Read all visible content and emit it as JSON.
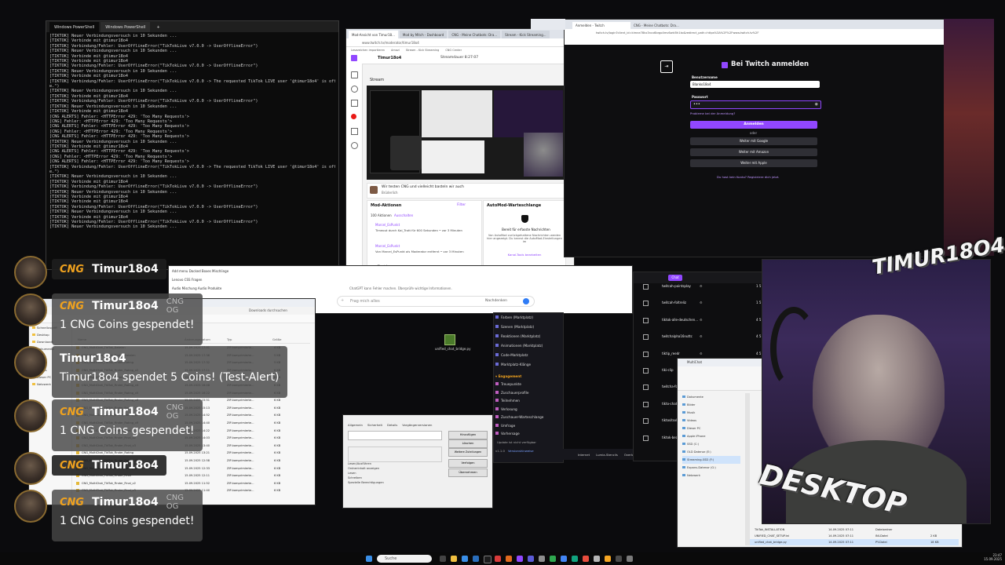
{
  "terminal": {
    "tabs": [
      "Windows PowerShell",
      "Windows PowerShell"
    ],
    "lines": [
      "[TIKTOK] Neuer Verbindungsversuch in 10 Sekunden ...",
      "[TIKTOK] Verbinde mit @timur18o4",
      "[TIKTOK] Verbindung/Fehler: UserOfflineError(\"TikTokLive v7.0.0 -> UserOfflineError\")",
      "[TIKTOK] Neuer Verbindungsversuch in 10 Sekunden ...",
      "[TIKTOK] Verbinde mit @timur18o4",
      "[TIKTOK] Verbinde mit @timur18o4",
      "[TIKTOK] Verbindung/Fehler: UserOfflineError(\"TikTokLive v7.0.0 -> UserOfflineError\")",
      "[TIKTOK] Neuer Verbindungsversuch in 10 Sekunden ...",
      "[TIKTOK] Verbinde mit @timur18o4",
      "[TIKTOK] Verbindung/Fehler: UserOfflineError(\"TikTokLive v7.0.0 -> The requested TikTok LIVE user '@timur18o4' is offlin",
      "e.\")",
      "[TIKTOK] Neuer Verbindungsversuch in 10 Sekunden ...",
      "[TIKTOK] Verbinde mit @timur18o4",
      "[TIKTOK] Verbindung/Fehler: UserOfflineError(\"TikTokLive v7.0.0 -> UserOfflineError\")",
      "[TIKTOK] Neuer Verbindungsversuch in 10 Sekunden ...",
      "[TIKTOK] Verbinde mit @timur18o4",
      "[CNG ALERTS] Fehler: <HTTPError 429: 'Too Many Requests'>",
      "[CNG] Fehler: <HTTPError 429: 'Too Many Requests'>",
      "[CNG ALERTS] Fehler: <HTTPError 429: 'Too Many Requests'>",
      "[CNG] Fehler: <HTTPError 429: 'Too Many Requests'>",
      "[CNG ALERTS] Fehler: <HTTPError 429: 'Too Many Requests'>",
      "[TIKTOK] Neuer Verbindungsversuch in 10 Sekunden ...",
      "[TIKTOK] Verbinde mit @timur18o4",
      "[CNG ALERTS] Fehler: <HTTPError 429: 'Too Many Requests'>",
      "[CNG] Fehler: <HTTPError 429: 'Too Many Requests'>",
      "[CNG ALERTS] Fehler: <HTTPError 429: 'Too Many Requests'>",
      "[TIKTOK] Verbindung/Fehler: UserOfflineError(\"TikTokLive v7.0.0 -> The requested TikTok LIVE user '@timur18o4' is offlin",
      "e.\")",
      "[TIKTOK] Neuer Verbindungsversuch in 10 Sekunden ...",
      "[TIKTOK] Verbinde mit @timur18o4",
      "[TIKTOK] Verbindung/Fehler: UserOfflineError(\"TikTokLive v7.0.0 -> UserOfflineError\")",
      "[TIKTOK] Neuer Verbindungsversuch in 10 Sekunden ...",
      "[TIKTOK] Verbinde mit @timur18o4",
      "[TIKTOK] Verbinde mit @timur18o4",
      "[TIKTOK] Verbindung/Fehler: UserOfflineError(\"TikTokLive v7.0.0 -> UserOfflineError\")",
      "[TIKTOK] Neuer Verbindungsversuch in 10 Sekunden ...",
      "[TIKTOK] Verbinde mit @timur18o4",
      "[TIKTOK] Verbindung/Fehler: UserOfflineError(\"TikTokLive v7.0.0 -> UserOfflineError\")",
      "[TIKTOK] Neuer Verbindungsversuch in 10 Sekunden ..."
    ]
  },
  "browser_main": {
    "tabs": [
      "Mod-Ansicht von Timur18...",
      "Mod by Mitch - Dashboard",
      "CNG - Meine Chatbots: Dra...",
      "Stream - Kick Streaming..."
    ],
    "address": "www.twitch.tv/moderator/timur18o4",
    "bookmarks": [
      "Lesezeichen importieren",
      "Amazi",
      "Stream - Kick Streaming",
      "CNG Center",
      "Mein Alexa für aus. Tipp",
      "Mein Account Plus"
    ],
    "channel": "Timur18o4",
    "uptime": "Streamdauer 8:27:07",
    "section_stream": "Stream",
    "chat_msg": "Wir testen CNG und vielleicht basteln wir auch",
    "chat_sub": "Brüderlich",
    "mod_actions_title": "Mod-Aktionen",
    "filter": "Filter",
    "automod_title": "AutoMod-Warteschlange",
    "mod_count": "100 Aktionen",
    "mod_count_link": "Ausschalten",
    "mod_entries": [
      {
        "user": "Marcel_EsPunkt",
        "text": "Timeout durch Kai_Trott für 600 Sekunden • vor 3 Minuten"
      },
      {
        "user": "Marcel_EsPunkt",
        "text": "Von Marcel_EsPunkt als Moderator entfernt • vor 3 Minuten"
      }
    ],
    "automod_ready": "Bereit für erfasste Nachrichten",
    "automod_desc": "Von AutoMod zurückgehaltene Nachrichten werden hier angezeigt. Du kannst die AutoMod-Einstellungen im",
    "automod_link": "Kanal-Tools bearbeiten",
    "chat_clear": "Chat leeren"
  },
  "twitch_login": {
    "tab": "Anmelden - Twitch",
    "tab2": "CNG - Meine Chatbots: Dra...",
    "tab3": "CNG Host",
    "address": "twitch.tv/login?client_id=kimne78kx3ncx6brgo4mv6wki5h1ko&redirect_path=https%3A%2F%2Fwww.twitch.tv%2F",
    "title": "Bei Twitch anmelden",
    "username_label": "Benutzername",
    "username_value": "Blanko18o4",
    "password_label": "Passwort",
    "password_value": "•••",
    "trouble_link": "Probleme bei der Anmeldung?",
    "login_button": "Anmelden",
    "or": "oder",
    "google": "Weiter mit Google",
    "amazon": "Weiter mit Amazon",
    "apple": "Weiter mit Apple",
    "register": "Du hast kein Konto? Registriere dich jetzt."
  },
  "google_bar": {
    "placeholder": "Frag mich alles",
    "btn": "Nachdenken",
    "hint": "ChatGPT kann Fehler machen. Überprüfe wichtige Informationen."
  },
  "explorer_left": {
    "suggestions": [
      "Add menu Docked Boxes Mischlinge",
      "Lenovo CSS Fragen",
      "Audio Mischung Audio Produkte"
    ],
    "path": "Downloads › unified_chat",
    "search": "Downloads durchsuchen",
    "cols": [
      "Name",
      "Änderungsdatum",
      "Typ",
      "Größe"
    ],
    "rows": [
      [
        "CNG_MultiChat_TikTok_Dateien",
        "15.09.2025 17:41",
        "ZIP-komprimierte...",
        "4 KB"
      ],
      [
        "CNG_MultiChat_TikTok_Finder_Dateien",
        "15.09.2025 17:36",
        "ZIP-komprimierte...",
        "5 KB"
      ],
      [
        "CNG_MultiChat_TikTok_Finder_Rating",
        "15.09.2025 17:32",
        "ZIP-komprimierte...",
        "5 KB"
      ],
      [
        "CNG_MultiChat_TikTok_Finder_Rating_v2",
        "15.09.2025 17:11",
        "ZIP-komprimierte...",
        "6 KB"
      ],
      [
        "CNG_MultiChat_TikTok_Finder_Rating_v3",
        "15.09.2025 17:06",
        "ZIP-komprimierte...",
        "6 KB"
      ],
      [
        "CNG_MultiChat_TikTok_Finder_Rating_v4",
        "15.09.2025 16:48",
        "ZIP-komprimierte...",
        "6 KB"
      ],
      [
        "CNG_MultiChat_TikTok_Finder_Rating_v5",
        "15.09.2025 16:22",
        "ZIP-komprimierte...",
        "6 KB"
      ],
      [
        "CNG_MultiChat_TikTok_Finder_Rating_v6",
        "15.09.2025 15:51",
        "ZIP-komprimierte...",
        "6 KB"
      ],
      [
        "CNG_MultiChat_TikTok_Finder_Rating_v7",
        "15.09.2025 15:13",
        "ZIP-komprimierte...",
        "6 KB"
      ],
      [
        "CNG_MultiChat_TikTok_Finder_Rating_v8",
        "15.09.2025 14:52",
        "ZIP-komprimierte...",
        "6 KB"
      ],
      [
        "CNG_MultiChat_TikTok_Finder_Rating_v9",
        "15.09.2025 14:40",
        "ZIP-komprimierte...",
        "6 KB"
      ],
      [
        "CNG_MultiChat_TikTok_Finder_Final",
        "15.09.2025 14:22",
        "ZIP-komprimierte...",
        "6 KB"
      ],
      [
        "CNG_MultiChat_TikTok_Finder_Final_v2",
        "15.09.2025 14:03",
        "ZIP-komprimierte...",
        "6 KB"
      ],
      [
        "CNG_MultiChat_TikTok_Finder_Final_v3",
        "15.09.2025 13:40",
        "ZIP-komprimierte...",
        "6 KB"
      ],
      [
        "CNG_MultiChat_TikTok_Finder_Rating",
        "15.09.2025 13:21",
        "ZIP-komprimierte...",
        "6 KB"
      ],
      [
        "CNG_MultiChat_TikTok_Finder_Rating_v2",
        "15.09.2025 12:58",
        "ZIP-komprimierte...",
        "6 KB"
      ],
      [
        "CNG_MultiChat_TikTok_Finder_Rating_v3",
        "15.09.2025 12:33",
        "ZIP-komprimierte...",
        "6 KB"
      ],
      [
        "CNG_MultiChat_TikTok_Finder_Final",
        "15.09.2025 12:11",
        "ZIP-komprimierte...",
        "6 KB"
      ],
      [
        "CNG_MultiChat_TikTok_Finder_Final_v2",
        "15.09.2025 11:52",
        "ZIP-komprimierte...",
        "6 KB"
      ],
      [
        "CNG_MultiChat_TikTok_Finder_Final_v3",
        "15.09.2025 11:40",
        "ZIP-komprimierte...",
        "6 KB"
      ]
    ],
    "side": [
      "Schnellzugriff",
      "Desktop",
      "Downloads",
      "Dokumente",
      "Bilder",
      "Musik",
      "Videos",
      "Dieser PC",
      "Netzwerk"
    ]
  },
  "desktop_icon": "unified_chat_bridge.py",
  "dialog": {
    "tabs": [
      "Allgemein",
      "Sicherheit",
      "Details",
      "Vorgängerversionen"
    ],
    "btns": [
      "Hinzufügen",
      "Löschen",
      "Weitere Zuteilungen",
      "Verfolgen",
      "Übernehmen"
    ],
    "opts": [
      "Lesen/Ausführen",
      "Ordnerinhalt anzeigen",
      "Lesen",
      "Schreiben",
      "Spezielle Berechtigungen"
    ]
  },
  "streamerbot": {
    "items": [
      "Farben (Marktplatz)",
      "Szenen (Marktplatz)",
      "Reaktionen (Marktplatz)",
      "Animationen (Marktplatz)",
      "Code-Marktplatz",
      "Marktplatz-Klänge"
    ],
    "section": "Engagement",
    "items2": [
      "Treuepunkte",
      "Zuschauerprofile",
      "Teilnehmen",
      "Verlosung",
      "Zuschauer-Warteschlange",
      "Umfrage",
      "Vorhersage"
    ],
    "version": "v1.1.0",
    "version_link": "Versionshinweise",
    "update": "Update ist nicht verfügbar",
    "footer": [
      "Internet",
      "Lumia-Stencils",
      "Overlays",
      "Chat-Bot"
    ]
  },
  "twitch_list": {
    "chat_tab": "Chat",
    "rows": [
      {
        "name": "twitcah-pointsplay",
        "num": "1 5"
      },
      {
        "name": "twitcah-foltreliz",
        "num": "1 5"
      },
      {
        "name": "tiktok-alle-deutschen...",
        "num": "4 5"
      },
      {
        "name": "twitchalpha16nuttc",
        "num": "4 5"
      },
      {
        "name": "tiktip_reedr",
        "num": "4 5"
      },
      {
        "name": "tiki-clip",
        "num": "4 5"
      },
      {
        "name": "twitcha-foul...",
        "num": "4 5"
      },
      {
        "name": "tikto-chat-ha...",
        "num": "4 5"
      },
      {
        "name": "tiktositsvldta",
        "num": "4 5"
      },
      {
        "name": "tiktok-beauteous",
        "num": "4 5"
      }
    ]
  },
  "explorer_right": {
    "title": "MultiChat",
    "side": [
      "Dokumente",
      "Bilder",
      "Musik",
      "Videos",
      "Dieser PC",
      "Apple iPhone",
      "SSD (C:)",
      "OLD Datenor (E:)",
      "Streaming-SSD (F:)",
      "Expans-Datenor (G:)",
      "Netzwerk"
    ],
    "rows": [
      [
        "TikTok_INSTALLATION",
        "14.09.2025 07:11",
        "Dateiordner",
        ""
      ],
      [
        "UNIFIED_CHAT_SETUP.ini",
        "14.09.2025 07:11",
        "INI-Datei",
        "2 KB"
      ],
      [
        "unified_chat_bridge.py",
        "14.09.2025 07:11",
        "PY-Datei",
        "18 KB"
      ]
    ]
  },
  "overlay": {
    "logo_top": "TIMUR18O4",
    "logo_bottom": "DESKTOP"
  },
  "alerts": [
    {
      "cng": "CNG",
      "user": "Timur18o4",
      "tag": "",
      "msg": ""
    },
    {
      "cng": "CNG",
      "user": "Timur18o4",
      "tag": "CNG OG",
      "msg": "1 CNG Coins gespendet!"
    },
    {
      "cng": "",
      "user": "Timur18o4",
      "tag": "",
      "msg": "Timur18o4 spendet 5 Coins! (Test-Alert)"
    },
    {
      "cng": "CNG",
      "user": "Timur18o4",
      "tag": "CNG OG",
      "msg": "1 CNG Coins gespendet!"
    },
    {
      "cng": "CNG",
      "user": "Timur18o4",
      "tag": "",
      "msg": ""
    },
    {
      "cng": "CNG",
      "user": "Timur18o4",
      "tag": "CNG OG",
      "msg": "1 CNG Coins gespendet!"
    }
  ],
  "taskbar": {
    "search": "Suche",
    "time": "23:47",
    "date": "15.09.2025"
  },
  "colors": {
    "twitch_purple": "#9147ff",
    "cng_orange": "#f0a21e"
  }
}
